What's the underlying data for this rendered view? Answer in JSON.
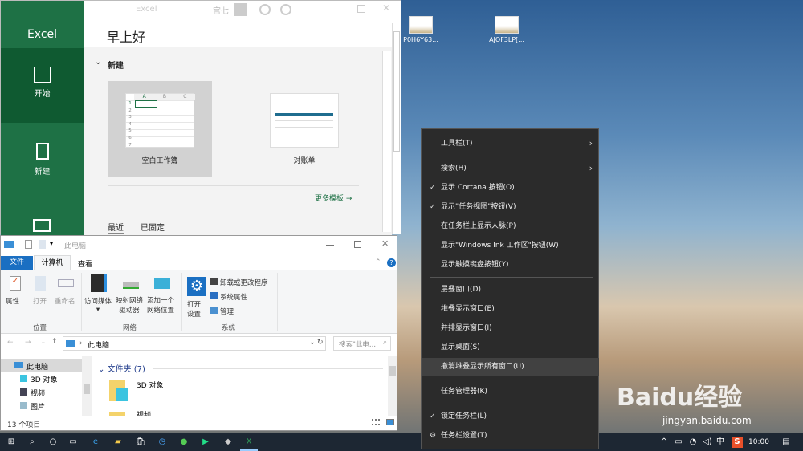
{
  "desktop": {
    "icons": [
      {
        "label": "P0H6Y63..."
      },
      {
        "label": "AJOF3LP[..."
      }
    ],
    "watermark": "Baidu经验",
    "watermark_url": "jingyan.baidu.com"
  },
  "excel": {
    "app_name": "Excel",
    "title_faded": "Excel",
    "user": "宫七",
    "greeting": "早上好",
    "nav": [
      {
        "label": "开始"
      },
      {
        "label": "新建"
      }
    ],
    "new_section": "新建",
    "templates": [
      {
        "label": "空白工作簿"
      },
      {
        "label": "对账单"
      }
    ],
    "col_headers": [
      "A",
      "B",
      "C"
    ],
    "row_headers": [
      "1",
      "2",
      "3",
      "4",
      "5",
      "6",
      "7"
    ],
    "more_templates": "更多模板",
    "tabs": [
      {
        "label": "最近"
      },
      {
        "label": "已固定"
      }
    ],
    "accent": "#1e7145"
  },
  "explorer": {
    "title": "此电脑",
    "ribbon_tabs": [
      {
        "label": "文件"
      },
      {
        "label": "计算机"
      },
      {
        "label": "查看"
      }
    ],
    "groups": {
      "location": {
        "label": "位置",
        "buttons": [
          "属性",
          "打开",
          "重命名"
        ]
      },
      "network": {
        "label": "网络",
        "buttons": [
          "访问媒体",
          "映射网络\n驱动器",
          "添加一个\n网络位置"
        ]
      },
      "system": {
        "label": "系统",
        "open_settings": "打开\n设置",
        "items": [
          "卸载或更改程序",
          "系统属性",
          "管理"
        ]
      }
    },
    "address": "此电脑",
    "search_placeholder": "搜索\"此电...",
    "nav_tree": [
      {
        "label": "此电脑"
      },
      {
        "label": "3D 对象"
      },
      {
        "label": "视频"
      },
      {
        "label": "图片"
      }
    ],
    "section": "文件夹 (7)",
    "items": [
      {
        "label": "3D 对象"
      },
      {
        "label": "视频"
      }
    ],
    "status": "13 个项目"
  },
  "context_menu": {
    "items": [
      {
        "label": "工具栏(T)",
        "submenu": true
      },
      {
        "label": "搜索(H)",
        "submenu": true
      },
      {
        "label": "显示 Cortana 按钮(O)",
        "checked": true
      },
      {
        "label": "显示\"任务视图\"按钮(V)",
        "checked": true
      },
      {
        "label": "在任务栏上显示人脉(P)"
      },
      {
        "label": "显示\"Windows Ink 工作区\"按钮(W)"
      },
      {
        "label": "显示触摸键盘按钮(Y)"
      },
      {
        "label": "层叠窗口(D)"
      },
      {
        "label": "堆叠显示窗口(E)"
      },
      {
        "label": "并排显示窗口(I)"
      },
      {
        "label": "显示桌面(S)"
      },
      {
        "label": "撤消堆叠显示所有窗口(U)",
        "highlighted": true
      },
      {
        "label": "任务管理器(K)"
      },
      {
        "label": "锁定任务栏(L)",
        "checked": true
      },
      {
        "label": "任务栏设置(T)",
        "icon": "gear-icon"
      }
    ]
  },
  "taskbar": {
    "ime": "中",
    "clock": "10:00",
    "sogou": "S"
  }
}
